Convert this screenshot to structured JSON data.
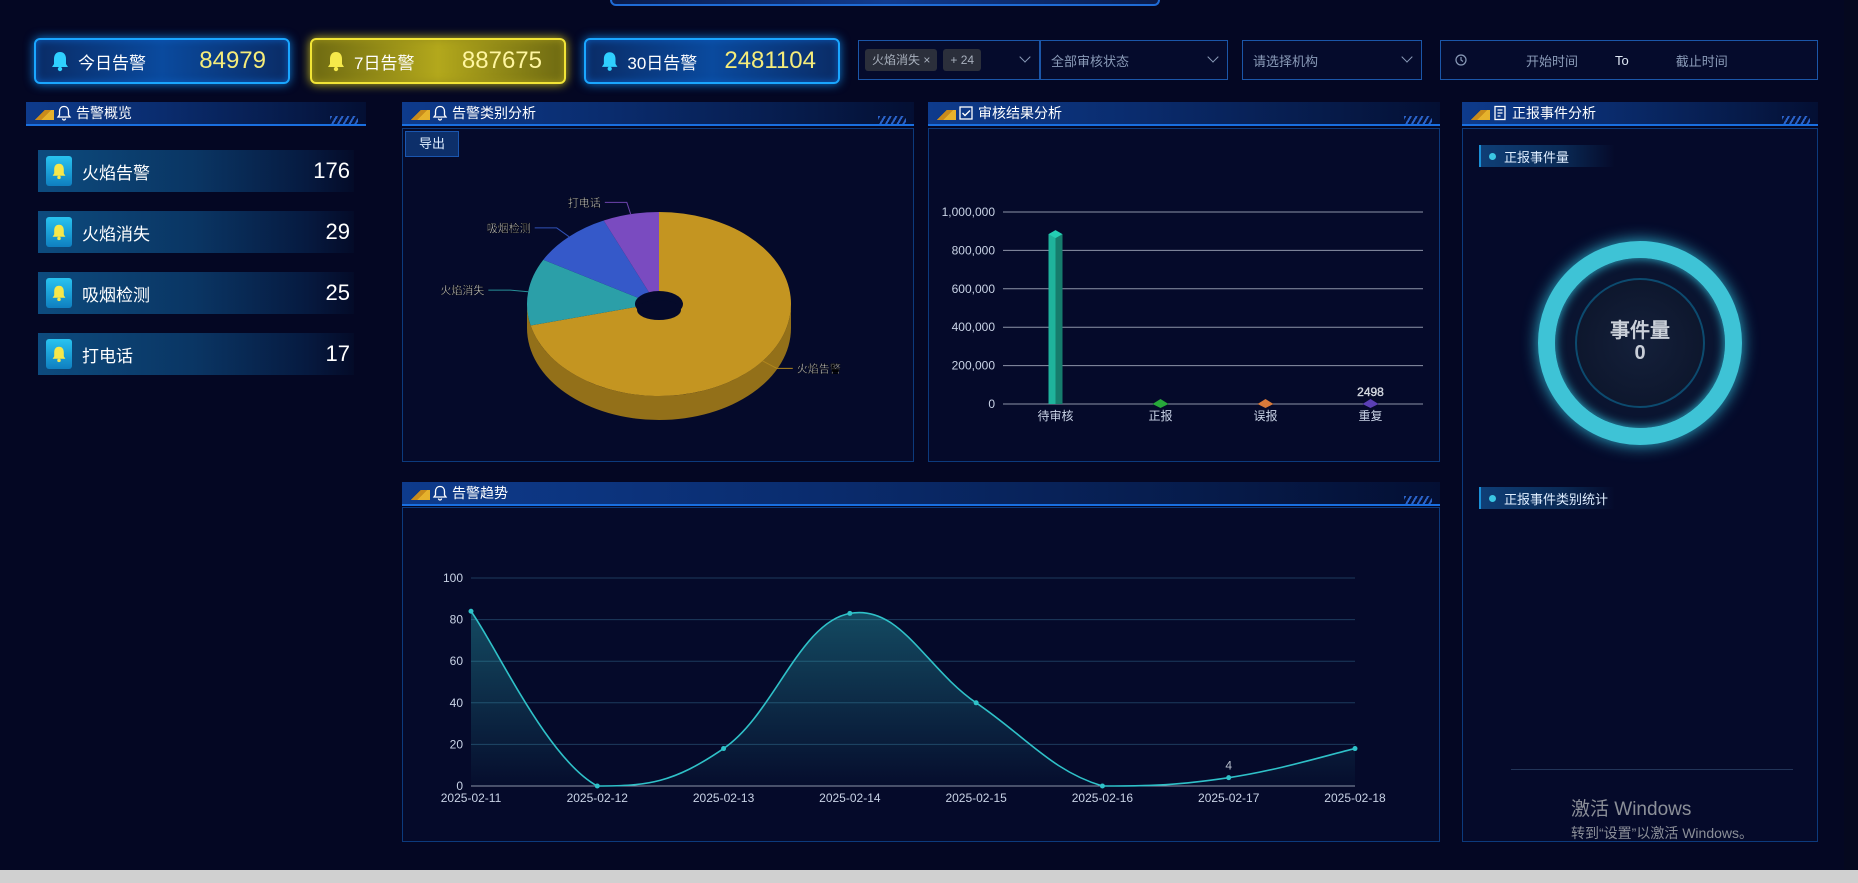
{
  "stats": [
    {
      "label": "今日告警",
      "value": "84979",
      "style": "blue"
    },
    {
      "label": "7日告警",
      "value": "887675",
      "style": "yellow"
    },
    {
      "label": "30日告警",
      "value": "2481104",
      "style": "blue"
    }
  ],
  "filters": {
    "type_tag": "火焰消失",
    "type_more": "+ 24",
    "review_status_placeholder": "全部审核状态",
    "org_placeholder": "请选择机构",
    "start_placeholder": "开始时间",
    "to_label": "To",
    "end_placeholder": "截止时间"
  },
  "panels": {
    "overview": "告警概览",
    "category": "告警类别分析",
    "review": "审核结果分析",
    "report": "正报事件分析",
    "trend": "告警趋势"
  },
  "overview_items": [
    {
      "label": "火焰告警",
      "value": "176"
    },
    {
      "label": "火焰消失",
      "value": "29"
    },
    {
      "label": "吸烟检测",
      "value": "25"
    },
    {
      "label": "打电话",
      "value": "17"
    }
  ],
  "export_label": "导出",
  "report": {
    "count_header": "正报事件量",
    "ring_title": "事件量",
    "ring_value": "0",
    "category_header": "正报事件类别统计"
  },
  "watermark": {
    "line1": "激活 Windows",
    "line2": "转到“设置”以激活 Windows。"
  },
  "chart_data": [
    {
      "type": "pie",
      "title": "告警类别分析",
      "slices": [
        {
          "label": "火焰告警",
          "value": 176,
          "color": "#c49521"
        },
        {
          "label": "火焰消失",
          "value": 29,
          "color": "#2b9fa8"
        },
        {
          "label": "吸烟检测",
          "value": 25,
          "color": "#3559c9"
        },
        {
          "label": "打电话",
          "value": 17,
          "color": "#7a4bc0"
        }
      ]
    },
    {
      "type": "bar",
      "title": "审核结果分析",
      "categories": [
        "待审核",
        "正报",
        "误报",
        "重复"
      ],
      "values": [
        885000,
        0,
        0,
        2498
      ],
      "colors": [
        "#1fb39c",
        "#27a83a",
        "#d87a3a",
        "#5b3fb5"
      ],
      "data_labels": [
        "",
        "",
        "",
        "2498"
      ],
      "ylim": [
        0,
        1000000
      ],
      "yticks": [
        "0",
        "200,000",
        "400,000",
        "600,000",
        "800,000",
        "1,000,000"
      ]
    },
    {
      "type": "area",
      "title": "告警趋势",
      "x": [
        "2025-02-11",
        "2025-02-12",
        "2025-02-13",
        "2025-02-14",
        "2025-02-15",
        "2025-02-16",
        "2025-02-17",
        "2025-02-18"
      ],
      "values": [
        84,
        0,
        18,
        83,
        40,
        0,
        4,
        18
      ],
      "data_labels": [
        "",
        "",
        "",
        "",
        "",
        "",
        "4",
        ""
      ],
      "ylim": [
        0,
        100
      ],
      "yticks": [
        "0",
        "20",
        "40",
        "60",
        "80",
        "100"
      ],
      "color": "#2fc1c8"
    }
  ]
}
